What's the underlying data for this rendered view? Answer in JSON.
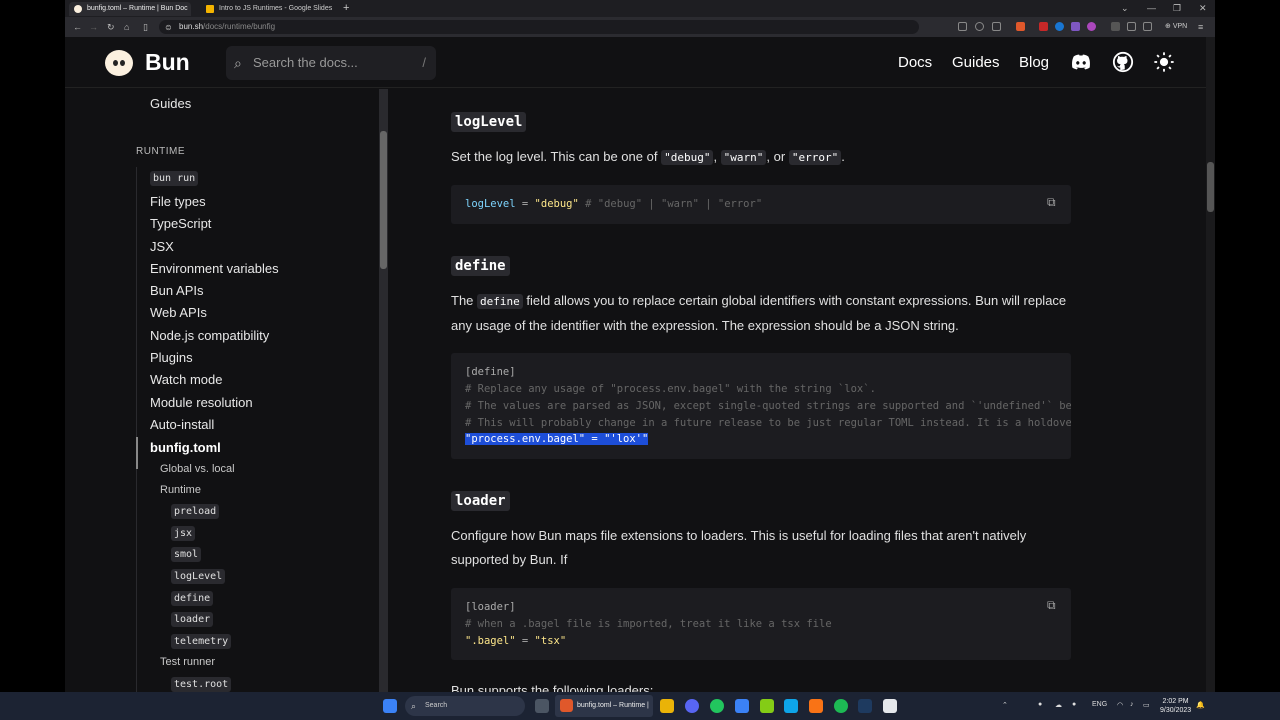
{
  "browser": {
    "tabs": [
      {
        "title": "bunfig.toml – Runtime | Bun Doc"
      },
      {
        "title": "Intro to JS Runtimes - Google Slides"
      }
    ],
    "new_tab": "+",
    "url_host": "bun.sh",
    "url_path": "/docs/runtime/bunfig",
    "vpn_label": "VPN"
  },
  "header": {
    "brand": "Bun",
    "search_placeholder": "Search the docs...",
    "search_shortcut": "/",
    "nav": [
      "Docs",
      "Guides",
      "Blog"
    ]
  },
  "sidebar": {
    "top_item": "Guides",
    "section": "RUNTIME",
    "items": [
      "bun run",
      "File types",
      "TypeScript",
      "JSX",
      "Environment variables",
      "Bun APIs",
      "Web APIs",
      "Node.js compatibility",
      "Plugins",
      "Watch mode",
      "Module resolution",
      "Auto-install",
      "bunfig.toml"
    ],
    "sub": [
      "Global vs. local",
      "Runtime"
    ],
    "runtime_items": [
      "preload",
      "jsx",
      "smol",
      "logLevel",
      "define",
      "loader",
      "telemetry"
    ],
    "test_runner": "Test runner",
    "test_items": [
      "test.root"
    ]
  },
  "content": {
    "s1": {
      "heading": "logLevel",
      "para_a": "Set the log level. This can be one of ",
      "opt1": "\"debug\"",
      "opt2": "\"warn\"",
      "para_b": ", or ",
      "opt3": "\"error\"",
      "para_c": ".",
      "code_key": "logLevel",
      "code_eq": " = ",
      "code_val": "\"debug\"",
      "code_comment": " # \"debug\" | \"warn\" | \"error\""
    },
    "s2": {
      "heading": "define",
      "para_a": "The ",
      "para_code": "define",
      "para_b": " field allows you to replace certain global identifiers with constant expressions. Bun will replace any usage of the identifier with the expression. The expression should be a JSON string.",
      "line1": "[define]",
      "line2": "# Replace any usage of \"process.env.bagel\" with the string `lox`.",
      "line3": "# The values are parsed as JSON, except single-quoted strings are supported and `'undefined'` becomes `undefined` in JS.",
      "line4": "# This will probably change in a future release to be just regular TOML instead. It is a holdover from the CLI argument parsing.",
      "line5": "\"process.env.bagel\" = \"'lox'\""
    },
    "s3": {
      "heading": "loader",
      "para": "Configure how Bun maps file extensions to loaders. This is useful for loading files that aren't natively supported by Bun. If",
      "line1": "[loader]",
      "line2": "# when a .bagel file is imported, treat it like a tsx file",
      "line3_key": "\".bagel\"",
      "line3_eq": " = ",
      "line3_val": "\"tsx\""
    },
    "cut_para": "Bun supports the following loaders:"
  },
  "taskbar": {
    "search": "Search",
    "active_app": "bunfig.toml – Runtime |",
    "lang": "ENG",
    "time": "2:02 PM",
    "date": "9/30/2023"
  }
}
